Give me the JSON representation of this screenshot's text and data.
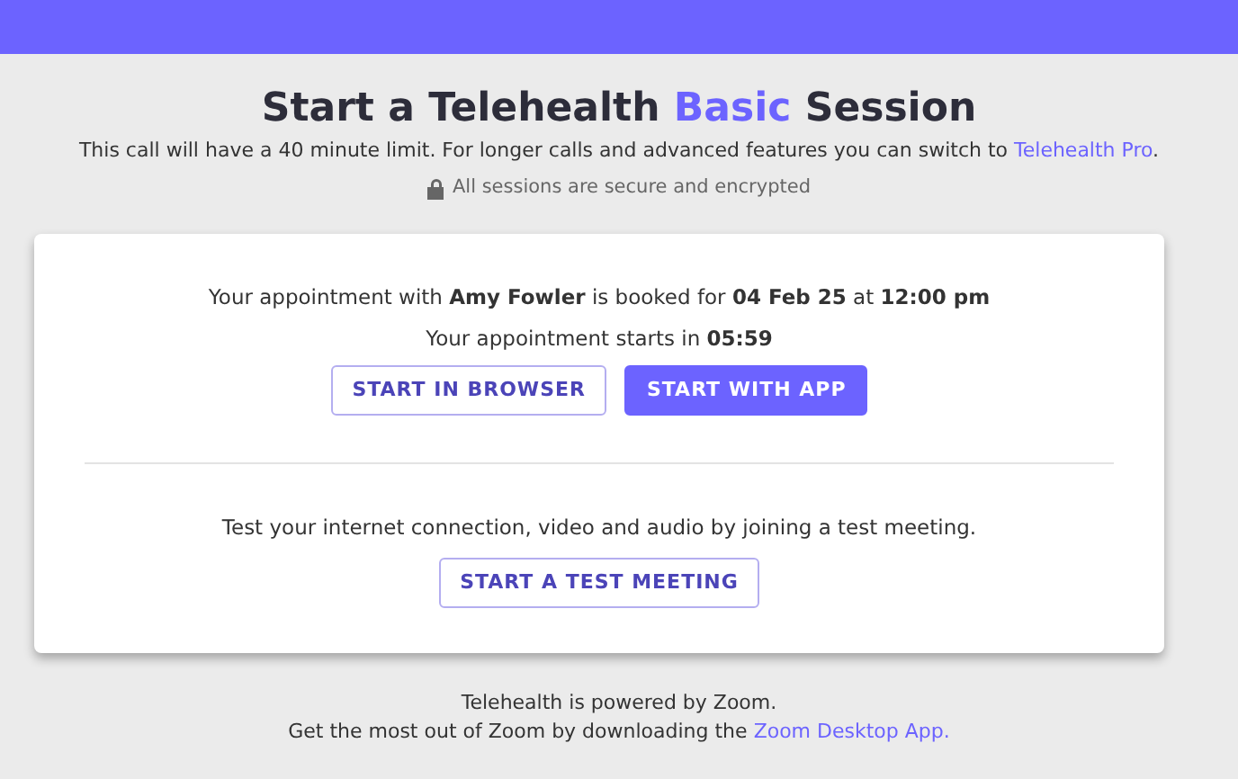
{
  "title_parts": [
    {
      "text": "Start a Telehealth ",
      "highlight": false
    },
    {
      "text": "Basic",
      "highlight": true
    },
    {
      "text": " Session",
      "highlight": false
    }
  ],
  "notice": {
    "text": "This call will have a 40 minute limit. For longer calls and advanced features you can switch to ",
    "link": "Telehealth Pro",
    "after": "."
  },
  "security_note": "All sessions are secure and encrypted",
  "appointment": {
    "details": "Your appointment with **Amy Fowler** is booked for **04 Feb 25** at **12:00 pm**",
    "countdown": "Your appointment starts in **05:59**",
    "buttons": [
      {
        "label": "START IN BROWSER",
        "kind": "outline"
      },
      {
        "label": "START WITH APP",
        "kind": "primary"
      }
    ]
  },
  "test": {
    "text": "Test your internet connection, video and audio by joining a test meeting.",
    "button": "START A TEST MEETING"
  },
  "footer": {
    "line_1": "Telehealth is powered by Zoom.",
    "line_2": "Get the most out of Zoom by downloading the ",
    "link": "Zoom Desktop App."
  }
}
